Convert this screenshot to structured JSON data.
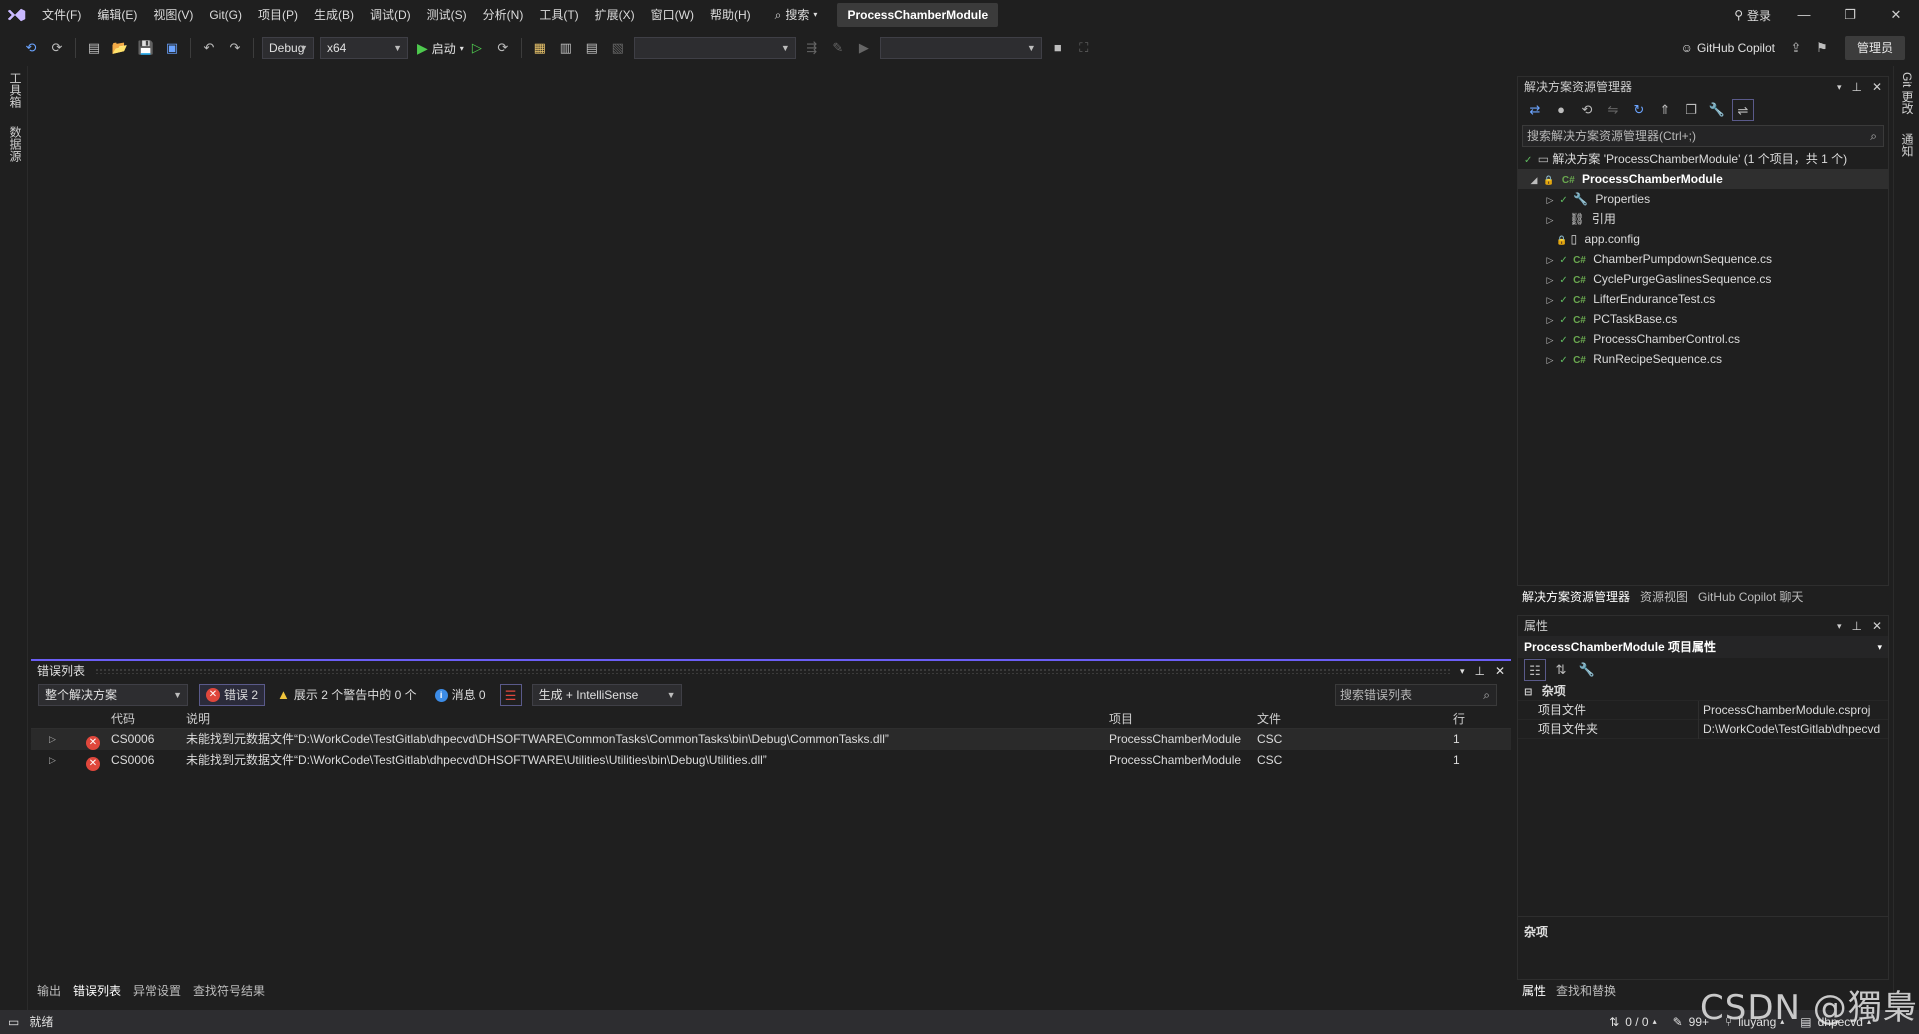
{
  "titlebar": {
    "menu": [
      "文件(F)",
      "编辑(E)",
      "视图(V)",
      "Git(G)",
      "项目(P)",
      "生成(B)",
      "调试(D)",
      "测试(S)",
      "分析(N)",
      "工具(T)",
      "扩展(X)",
      "窗口(W)",
      "帮助(H)"
    ],
    "search_label": "搜索",
    "project_title": "ProcessChamberModule",
    "login_label": "登录"
  },
  "toolbar": {
    "config": "Debug",
    "platform": "x64",
    "start_label": "启动",
    "copilot_label": "GitHub Copilot",
    "manage_label": "管理员"
  },
  "left_rail": [
    "工具箱",
    "数据源"
  ],
  "right_rail": [
    "Git 更改",
    "通知"
  ],
  "solution_explorer": {
    "title": "解决方案资源管理器",
    "search_placeholder": "搜索解决方案资源管理器(Ctrl+;)",
    "solution_label": "解决方案 'ProcessChamberModule' (1 个项目，共 1 个)",
    "project": "ProcessChamberModule",
    "items": [
      "Properties",
      "引用",
      "app.config",
      "ChamberPumpdownSequence.cs",
      "CyclePurgeGaslinesSequence.cs",
      "LifterEnduranceTest.cs",
      "PCTaskBase.cs",
      "ProcessChamberControl.cs",
      "RunRecipeSequence.cs"
    ],
    "tabs": [
      "解决方案资源管理器",
      "资源视图",
      "GitHub Copilot 聊天"
    ]
  },
  "properties": {
    "header": "属性",
    "title": "ProcessChamberModule 项目属性",
    "category": "杂项",
    "rows": [
      {
        "name": "项目文件",
        "value": "ProcessChamberModule.csproj"
      },
      {
        "name": "项目文件夹",
        "value": "D:\\WorkCode\\TestGitlab\\dhpecvd"
      }
    ],
    "desc_title": "杂项",
    "tabs": [
      "属性",
      "查找和替换"
    ]
  },
  "error_list": {
    "title": "错误列表",
    "scope": "整个解决方案",
    "errors_label": "错误 2",
    "warnings_label": "展示 2 个警告中的 0 个",
    "messages_label": "消息 0",
    "build_filter": "生成 + IntelliSense",
    "search_placeholder": "搜索错误列表",
    "columns": {
      "code": "代码",
      "desc": "说明",
      "project": "项目",
      "file": "文件",
      "line": "行"
    },
    "rows": [
      {
        "code": "CS0006",
        "desc": "未能找到元数据文件“D:\\WorkCode\\TestGitlab\\dhpecvd\\DHSOFTWARE\\CommonTasks\\CommonTasks\\bin\\Debug\\CommonTasks.dll”",
        "project": "ProcessChamberModule",
        "file": "CSC",
        "line": "1"
      },
      {
        "code": "CS0006",
        "desc": "未能找到元数据文件“D:\\WorkCode\\TestGitlab\\dhpecvd\\DHSOFTWARE\\Utilities\\Utilities\\bin\\Debug\\Utilities.dll”",
        "project": "ProcessChamberModule",
        "file": "CSC",
        "line": "1"
      }
    ],
    "tabs": [
      "输出",
      "错误列表",
      "异常设置",
      "查找符号结果"
    ]
  },
  "statusbar": {
    "ready": "就绪",
    "sync": "0 / 0",
    "edits": "99+",
    "branch": "liuyang",
    "repo": "dhpecvd"
  },
  "watermark": "CSDN @獨梟"
}
